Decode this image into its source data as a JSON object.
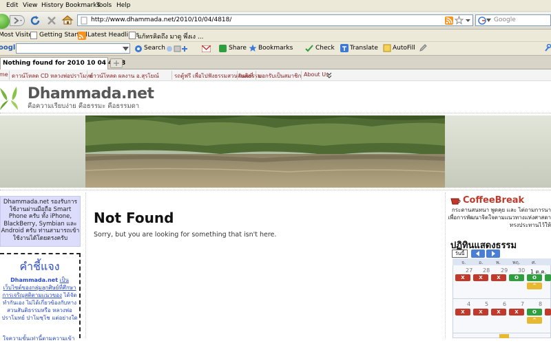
{
  "menu": [
    "Edit",
    "View",
    "History",
    "Bookmarks",
    "Tools",
    "Help"
  ],
  "url": "http://www.dhammada.net/2010/10/04/4818/",
  "search_placeholder": "Google",
  "bookmarks": [
    "Most Visited",
    "Getting Started",
    "Latest Headlines",
    "แก้ทรคิดถึง มาดู พึ่งเง ..."
  ],
  "google_toolbar": {
    "logo": "oogle",
    "search": "Search",
    "share": "Share",
    "bookmarks": "Bookmarks",
    "check": "Check",
    "translate": "Translate",
    "autofill": "AutoFill"
  },
  "tab_title": "Nothing found for 2010 10 04 4818",
  "site_nav": [
    "me",
    "ดาวน์โหลด CD หลวงพ่อปราโมทย์",
    "ดาวน์โหลด ผลงาน อ.สุรโยณ์",
    "รถตู้ฟรี เพื่อไปฟังธรรมสวนสันติธรรม",
    "แผนที่",
    "บอกรับเป็นสมาชิก",
    "About Us"
  ],
  "site": {
    "title": "Dhammada.net",
    "tagline": "คือความเรียบง่าย คือธรรมะ คือธรรมดา"
  },
  "notice": "Dhammada.net รองรับการใช้งานผ่านมือถือ Smart Phone ครับ ทั้ง iPhone, BlackBerry, Symbian และ Android ครับ ท่านสามารถเข้าใช้งานได้โดยตรงครับ",
  "explain": {
    "title": "คำชี้แจง",
    "brand": "Dhammada.net",
    "text1": "เป็นเว็บไซต์ของกลุ่มลูกศิษย์ที่ศึกษาการเจริญสติตามแนวของ",
    "text2": "ได้จัดทำกันเอง ไม่ได้เกี่ยวข้องกับทาง สวนสันติธรรมหรือ หลวงพ่อปราโมทย์ ปาโมชฺโช แต่อย่างใด",
    "text3": "ใจความขั้นเท่านี้ตามความเข้า"
  },
  "main": {
    "heading": "Not Found",
    "message": "Sorry, but you are looking for something that isn't here."
  },
  "coffee": {
    "title": "CoffeeBreak",
    "text": "กระดานสนทนา พูดคุย และ ไต่ถามการนา เพื่อการพัฒนาจิตใจตามแนวทางแห่งศาสดาทรงประทานไว้ให้"
  },
  "calendar": {
    "title": "ปฏิทินแสดงธรรม",
    "today_label": "วันนี้",
    "days": [
      "จ.",
      "อ.",
      "พ.",
      "พฤ.",
      "ศ."
    ],
    "week1": [
      "27",
      "28",
      "29",
      "30",
      "1 ต.ค."
    ],
    "week2": [
      "4",
      "5",
      "6",
      "7",
      "8"
    ],
    "chip_x": "X",
    "chip_o": "O",
    "chip_caret": "^"
  }
}
